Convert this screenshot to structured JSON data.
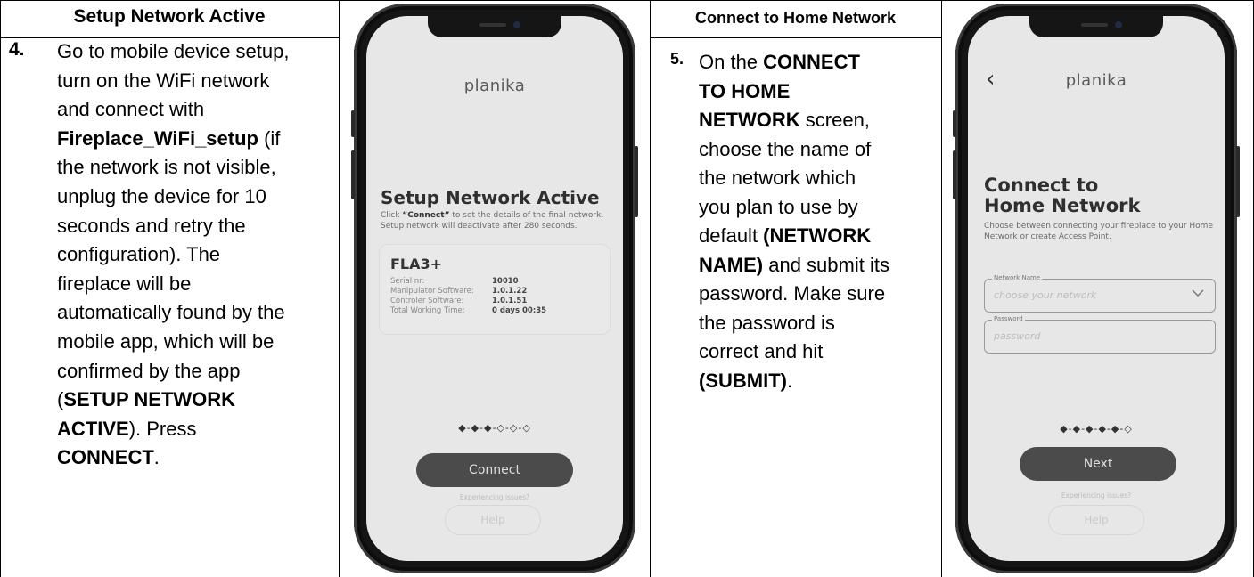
{
  "step4": {
    "header": "Setup Network Active",
    "number": "4.",
    "lines": [
      [
        {
          "t": "Go to mobile device setup,",
          "b": false
        }
      ],
      [
        {
          "t": "turn on the WiFi network",
          "b": false
        }
      ],
      [
        {
          "t": "and connect with",
          "b": false
        }
      ],
      [
        {
          "t": "Fireplace_WiFi_setup",
          "b": true
        },
        {
          "t": " (if",
          "b": false
        }
      ],
      [
        {
          "t": "the network is not visible,",
          "b": false
        }
      ],
      [
        {
          "t": "unplug the device for 10",
          "b": false
        }
      ],
      [
        {
          "t": "seconds and retry the",
          "b": false
        }
      ],
      [
        {
          "t": "configuration). The",
          "b": false
        }
      ],
      [
        {
          "t": "fireplace will be",
          "b": false
        }
      ],
      [
        {
          "t": "automatically found by the",
          "b": false
        }
      ],
      [
        {
          "t": "mobile app, which will be",
          "b": false
        }
      ],
      [
        {
          "t": "confirmed by the app",
          "b": false
        }
      ],
      [
        {
          "t": "(",
          "b": false
        },
        {
          "t": "SETUP NETWORK",
          "b": true
        }
      ],
      [
        {
          "t": "ACTIVE",
          "b": true
        },
        {
          "t": "). Press",
          "b": false
        }
      ],
      [
        {
          "t": "CONNECT",
          "b": true
        },
        {
          "t": ".",
          "b": false
        }
      ]
    ]
  },
  "step5": {
    "header": "Connect to Home Network",
    "number": "5.",
    "lines": [
      [
        {
          "t": "On the ",
          "b": false
        },
        {
          "t": "CONNECT",
          "b": true
        }
      ],
      [
        {
          "t": "TO HOME",
          "b": true
        }
      ],
      [
        {
          "t": "NETWORK",
          "b": true
        },
        {
          "t": " screen,",
          "b": false
        }
      ],
      [
        {
          "t": "choose the name of",
          "b": false
        }
      ],
      [
        {
          "t": "the network which",
          "b": false
        }
      ],
      [
        {
          "t": "you plan to use by",
          "b": false
        }
      ],
      [
        {
          "t": "default ",
          "b": false
        },
        {
          "t": "(NETWORK",
          "b": true
        }
      ],
      [
        {
          "t": "NAME)",
          "b": true
        },
        {
          "t": " and submit its",
          "b": false
        }
      ],
      [
        {
          "t": "password. Make sure",
          "b": false
        }
      ],
      [
        {
          "t": "the password is",
          "b": false
        }
      ],
      [
        {
          "t": "correct and hit",
          "b": false
        }
      ],
      [
        {
          "t": "(SUBMIT)",
          "b": true
        },
        {
          "t": ".",
          "b": false
        }
      ]
    ]
  },
  "phone1": {
    "brand": "planika",
    "title": "Setup Network Active",
    "desc_pre": "Click ",
    "desc_bold": "“Connect”",
    "desc_post": " to set the details of the final network. Setup network will deactivate after 280 seconds.",
    "device": {
      "name": "FLA3+",
      "rows": [
        {
          "key": "Serial nr:",
          "value": "10010"
        },
        {
          "key": "Manipulator Software:",
          "value": "1.0.1.22"
        },
        {
          "key": "Controler Software:",
          "value": "1.0.1.51"
        },
        {
          "key": "Total Working Time:",
          "value": "0 days  00:35"
        }
      ]
    },
    "progress": "◆-◆-◆-◇-◇-◇",
    "primary_button": "Connect",
    "issues_text": "Experiencing issues?",
    "help_button": "Help"
  },
  "phone2": {
    "brand": "planika",
    "back_icon": "‹",
    "title_line1": "Connect to",
    "title_line2": "Home Network",
    "desc": "Choose between connecting your fireplace to your Home Network or create Access Point.",
    "network_field": {
      "label": "Network Name",
      "placeholder": "choose your network"
    },
    "password_field": {
      "label": "Password",
      "placeholder": "password"
    },
    "progress": "◆-◆-◆-◆-◆-◇",
    "primary_button": "Next",
    "issues_text": "Experiencing issues?",
    "help_button": "Help"
  }
}
